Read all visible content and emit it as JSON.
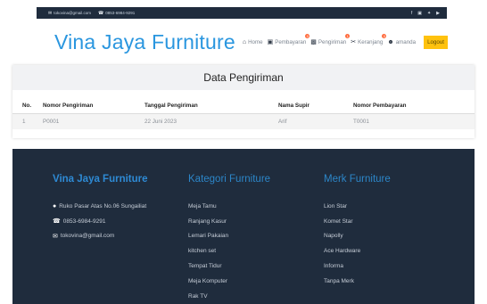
{
  "topbar": {
    "email": "tokovina@gmail.com",
    "phone": "0853-6984-9291",
    "social_icons": [
      "facebook-icon",
      "instagram-icon",
      "twitter-icon",
      "youtube-icon"
    ]
  },
  "brand": {
    "name": "Vina Jaya Furniture",
    "color": "#2a96df"
  },
  "nav": {
    "home": "Home",
    "pembayaran": "Pembayaran",
    "pembayaran_badge": "0",
    "pengiriman": "Pengiriman",
    "pengiriman_badge": "1",
    "keranjang": "Keranjang",
    "keranjang_badge": "0",
    "user": "amanda",
    "logout": "Logout",
    "logout_color": "#ffc20e"
  },
  "main": {
    "title": "Data Pengiriman",
    "columns": [
      "No.",
      "Nomor Pengiriman",
      "Tanggal Pengiriman",
      "Nama Supir",
      "Nomor Pembayaran"
    ],
    "rows": [
      [
        "1",
        "P0001",
        "22 Juni 2023",
        "Arif",
        "T0001"
      ]
    ]
  },
  "footer": {
    "background": "#1f2c3d",
    "about": {
      "title": "Vina Jaya Furniture",
      "address": "Ruko Pasar Atas No.06 Sungailiat",
      "phone": "0853-6984-9291",
      "email": "tokovina@gmail.com"
    },
    "kategori": {
      "title": "Kategori Furniture",
      "items": [
        "Meja Tamu",
        "Ranjang Kasur",
        "Lemari Pakaian",
        "kitchen set",
        "Tempat Tidur",
        "Meja Komputer",
        "Rak TV"
      ]
    },
    "merk": {
      "title": "Merk Furniture",
      "items": [
        "Lion Star",
        "Komet Star",
        "Napolly",
        "Ace Hardware",
        "Informa",
        "Tanpa Merk"
      ]
    }
  }
}
